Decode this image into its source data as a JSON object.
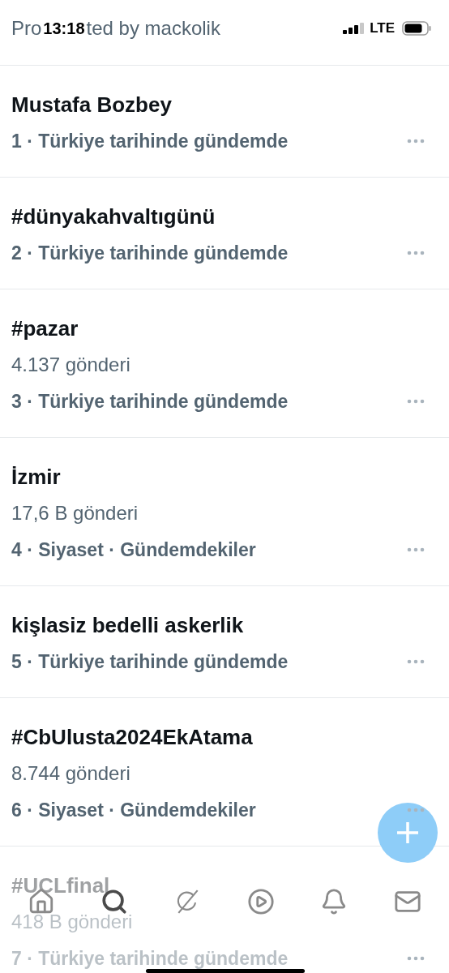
{
  "status_bar": {
    "time": "13:18",
    "network": "LTE"
  },
  "promoted": [
    "Pro",
    "ted by mackolik"
  ],
  "trends": [
    {
      "title": "Mustafa Bozbey",
      "meta": "1 · Türkiye tarihinde gündemde"
    },
    {
      "title": "#dünyakahvaltıgünü",
      "meta": "2 · Türkiye tarihinde gündemde"
    },
    {
      "title": "#pazar",
      "count": "4.137 gönderi",
      "meta": "3 · Türkiye tarihinde gündemde"
    },
    {
      "title": "İzmir",
      "count": "17,6 B gönderi",
      "meta": "4 · Siyaset · Gündemdekiler"
    },
    {
      "title": "kişlasiz bedelli askerlik",
      "meta": "5 · Türkiye tarihinde gündemde"
    },
    {
      "title": "#CbUlusta2024EkAtama",
      "count": "8.744 gönderi",
      "meta": "6 · Siyaset · Gündemdekiler"
    },
    {
      "title": "#UCLfinal",
      "count": "418 B gönderi",
      "meta": "7 · Türkiye tarihinde gündemde"
    }
  ],
  "tab_bar": [
    {
      "kind": "home",
      "selected": false
    },
    {
      "kind": "search",
      "selected": true
    },
    {
      "kind": "grok",
      "selected": false
    },
    {
      "kind": "video",
      "selected": false
    },
    {
      "kind": "notifications",
      "selected": false
    },
    {
      "kind": "messages",
      "selected": false
    }
  ]
}
